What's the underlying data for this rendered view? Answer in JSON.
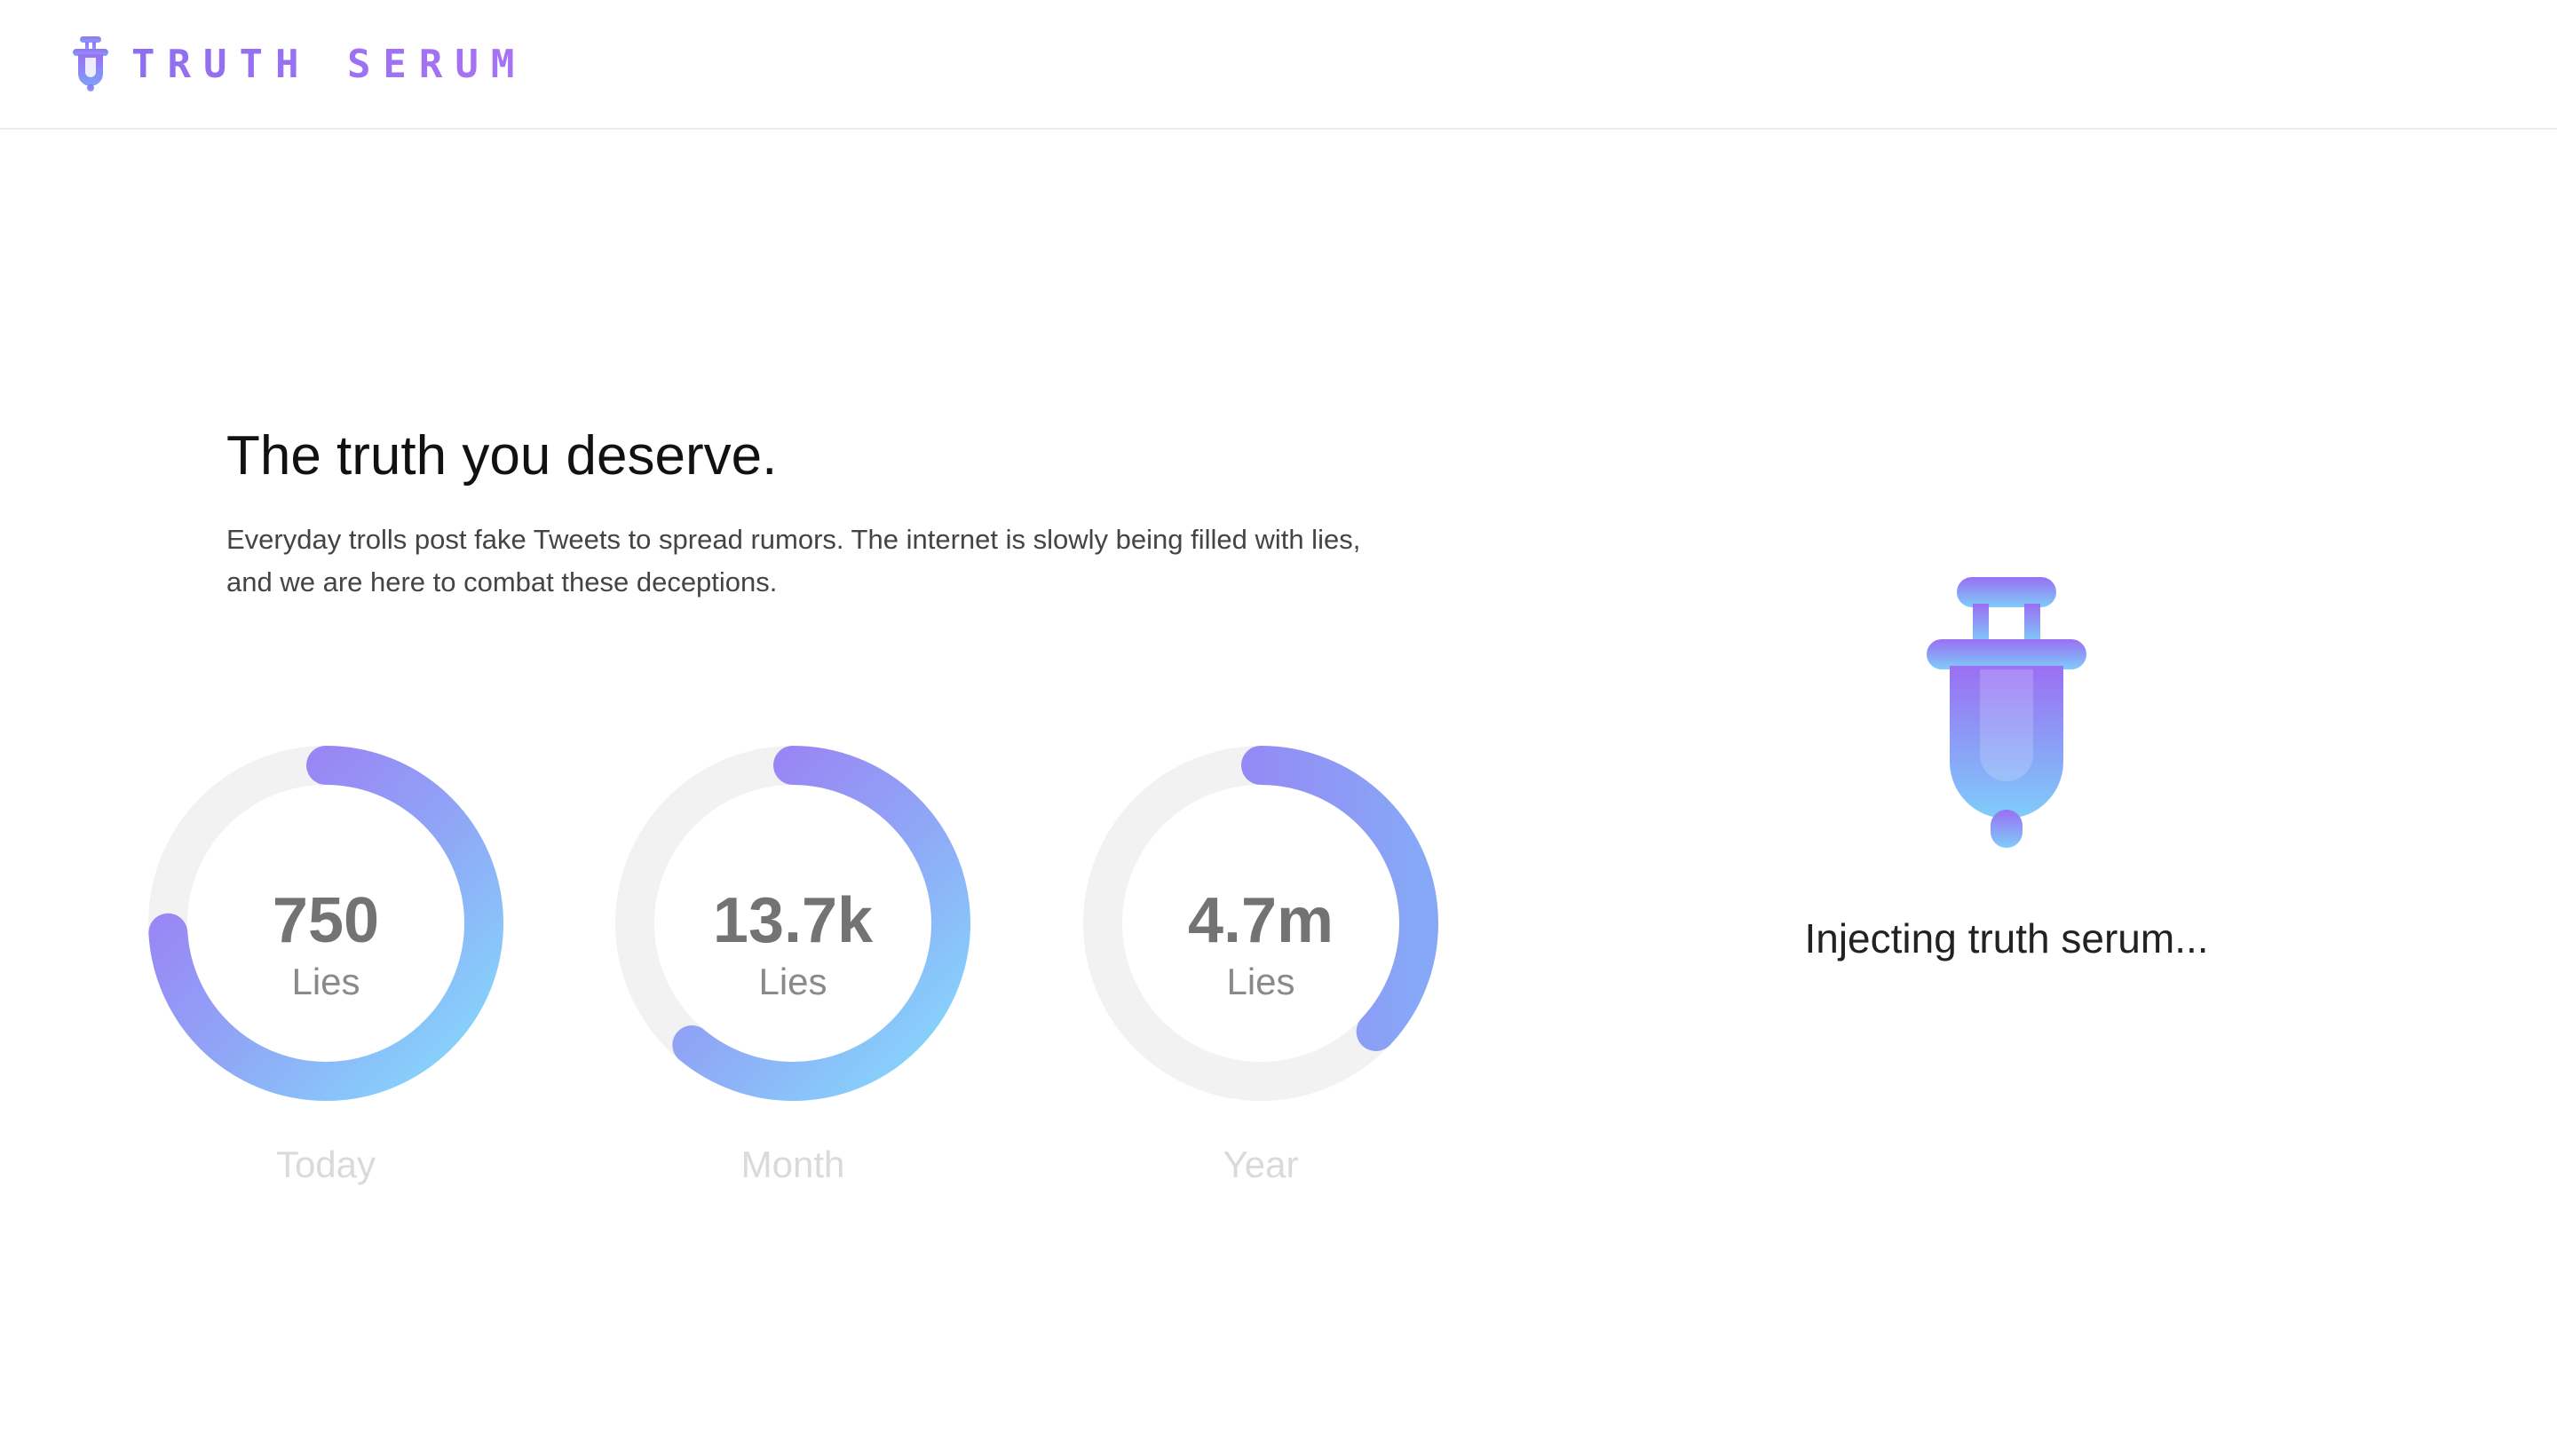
{
  "header": {
    "logo_text": "TRUTH SERUM",
    "logo_icon": "syringe-icon"
  },
  "hero": {
    "title": "The truth you deserve.",
    "description": "Everyday trolls post fake Tweets to spread rumors. The internet is slowly being filled with lies, and we are here to combat these deceptions."
  },
  "stats": [
    {
      "value": "750",
      "unit": "Lies",
      "period": "Today",
      "progress": 0.74
    },
    {
      "value": "13.7k",
      "unit": "Lies",
      "period": "Month",
      "progress": 0.61
    },
    {
      "value": "4.7m",
      "unit": "Lies",
      "period": "Year",
      "progress": 0.37
    }
  ],
  "loader": {
    "icon": "syringe-icon",
    "text": "Injecting truth serum..."
  },
  "colors": {
    "accent_purple": "#9b6cf4",
    "accent_blue": "#84dafd",
    "ring_track": "#f2f2f2",
    "brand_text": "#9a6cf2"
  }
}
